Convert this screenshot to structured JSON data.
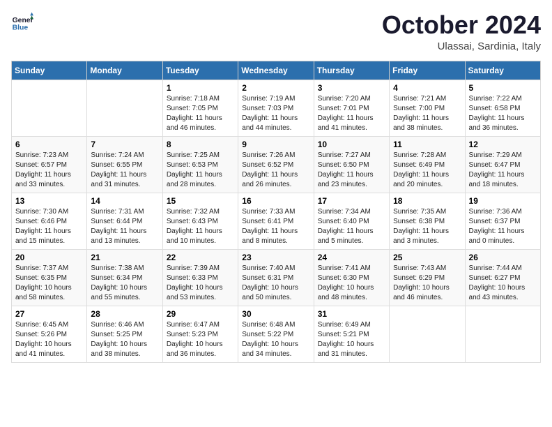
{
  "header": {
    "logo_line1": "General",
    "logo_line2": "Blue",
    "month_title": "October 2024",
    "location": "Ulassai, Sardinia, Italy"
  },
  "days_of_week": [
    "Sunday",
    "Monday",
    "Tuesday",
    "Wednesday",
    "Thursday",
    "Friday",
    "Saturday"
  ],
  "weeks": [
    [
      {
        "day": "",
        "sunrise": "",
        "sunset": "",
        "daylight": ""
      },
      {
        "day": "",
        "sunrise": "",
        "sunset": "",
        "daylight": ""
      },
      {
        "day": "1",
        "sunrise": "Sunrise: 7:18 AM",
        "sunset": "Sunset: 7:05 PM",
        "daylight": "Daylight: 11 hours and 46 minutes."
      },
      {
        "day": "2",
        "sunrise": "Sunrise: 7:19 AM",
        "sunset": "Sunset: 7:03 PM",
        "daylight": "Daylight: 11 hours and 44 minutes."
      },
      {
        "day": "3",
        "sunrise": "Sunrise: 7:20 AM",
        "sunset": "Sunset: 7:01 PM",
        "daylight": "Daylight: 11 hours and 41 minutes."
      },
      {
        "day": "4",
        "sunrise": "Sunrise: 7:21 AM",
        "sunset": "Sunset: 7:00 PM",
        "daylight": "Daylight: 11 hours and 38 minutes."
      },
      {
        "day": "5",
        "sunrise": "Sunrise: 7:22 AM",
        "sunset": "Sunset: 6:58 PM",
        "daylight": "Daylight: 11 hours and 36 minutes."
      }
    ],
    [
      {
        "day": "6",
        "sunrise": "Sunrise: 7:23 AM",
        "sunset": "Sunset: 6:57 PM",
        "daylight": "Daylight: 11 hours and 33 minutes."
      },
      {
        "day": "7",
        "sunrise": "Sunrise: 7:24 AM",
        "sunset": "Sunset: 6:55 PM",
        "daylight": "Daylight: 11 hours and 31 minutes."
      },
      {
        "day": "8",
        "sunrise": "Sunrise: 7:25 AM",
        "sunset": "Sunset: 6:53 PM",
        "daylight": "Daylight: 11 hours and 28 minutes."
      },
      {
        "day": "9",
        "sunrise": "Sunrise: 7:26 AM",
        "sunset": "Sunset: 6:52 PM",
        "daylight": "Daylight: 11 hours and 26 minutes."
      },
      {
        "day": "10",
        "sunrise": "Sunrise: 7:27 AM",
        "sunset": "Sunset: 6:50 PM",
        "daylight": "Daylight: 11 hours and 23 minutes."
      },
      {
        "day": "11",
        "sunrise": "Sunrise: 7:28 AM",
        "sunset": "Sunset: 6:49 PM",
        "daylight": "Daylight: 11 hours and 20 minutes."
      },
      {
        "day": "12",
        "sunrise": "Sunrise: 7:29 AM",
        "sunset": "Sunset: 6:47 PM",
        "daylight": "Daylight: 11 hours and 18 minutes."
      }
    ],
    [
      {
        "day": "13",
        "sunrise": "Sunrise: 7:30 AM",
        "sunset": "Sunset: 6:46 PM",
        "daylight": "Daylight: 11 hours and 15 minutes."
      },
      {
        "day": "14",
        "sunrise": "Sunrise: 7:31 AM",
        "sunset": "Sunset: 6:44 PM",
        "daylight": "Daylight: 11 hours and 13 minutes."
      },
      {
        "day": "15",
        "sunrise": "Sunrise: 7:32 AM",
        "sunset": "Sunset: 6:43 PM",
        "daylight": "Daylight: 11 hours and 10 minutes."
      },
      {
        "day": "16",
        "sunrise": "Sunrise: 7:33 AM",
        "sunset": "Sunset: 6:41 PM",
        "daylight": "Daylight: 11 hours and 8 minutes."
      },
      {
        "day": "17",
        "sunrise": "Sunrise: 7:34 AM",
        "sunset": "Sunset: 6:40 PM",
        "daylight": "Daylight: 11 hours and 5 minutes."
      },
      {
        "day": "18",
        "sunrise": "Sunrise: 7:35 AM",
        "sunset": "Sunset: 6:38 PM",
        "daylight": "Daylight: 11 hours and 3 minutes."
      },
      {
        "day": "19",
        "sunrise": "Sunrise: 7:36 AM",
        "sunset": "Sunset: 6:37 PM",
        "daylight": "Daylight: 11 hours and 0 minutes."
      }
    ],
    [
      {
        "day": "20",
        "sunrise": "Sunrise: 7:37 AM",
        "sunset": "Sunset: 6:35 PM",
        "daylight": "Daylight: 10 hours and 58 minutes."
      },
      {
        "day": "21",
        "sunrise": "Sunrise: 7:38 AM",
        "sunset": "Sunset: 6:34 PM",
        "daylight": "Daylight: 10 hours and 55 minutes."
      },
      {
        "day": "22",
        "sunrise": "Sunrise: 7:39 AM",
        "sunset": "Sunset: 6:33 PM",
        "daylight": "Daylight: 10 hours and 53 minutes."
      },
      {
        "day": "23",
        "sunrise": "Sunrise: 7:40 AM",
        "sunset": "Sunset: 6:31 PM",
        "daylight": "Daylight: 10 hours and 50 minutes."
      },
      {
        "day": "24",
        "sunrise": "Sunrise: 7:41 AM",
        "sunset": "Sunset: 6:30 PM",
        "daylight": "Daylight: 10 hours and 48 minutes."
      },
      {
        "day": "25",
        "sunrise": "Sunrise: 7:43 AM",
        "sunset": "Sunset: 6:29 PM",
        "daylight": "Daylight: 10 hours and 46 minutes."
      },
      {
        "day": "26",
        "sunrise": "Sunrise: 7:44 AM",
        "sunset": "Sunset: 6:27 PM",
        "daylight": "Daylight: 10 hours and 43 minutes."
      }
    ],
    [
      {
        "day": "27",
        "sunrise": "Sunrise: 6:45 AM",
        "sunset": "Sunset: 5:26 PM",
        "daylight": "Daylight: 10 hours and 41 minutes."
      },
      {
        "day": "28",
        "sunrise": "Sunrise: 6:46 AM",
        "sunset": "Sunset: 5:25 PM",
        "daylight": "Daylight: 10 hours and 38 minutes."
      },
      {
        "day": "29",
        "sunrise": "Sunrise: 6:47 AM",
        "sunset": "Sunset: 5:23 PM",
        "daylight": "Daylight: 10 hours and 36 minutes."
      },
      {
        "day": "30",
        "sunrise": "Sunrise: 6:48 AM",
        "sunset": "Sunset: 5:22 PM",
        "daylight": "Daylight: 10 hours and 34 minutes."
      },
      {
        "day": "31",
        "sunrise": "Sunrise: 6:49 AM",
        "sunset": "Sunset: 5:21 PM",
        "daylight": "Daylight: 10 hours and 31 minutes."
      },
      {
        "day": "",
        "sunrise": "",
        "sunset": "",
        "daylight": ""
      },
      {
        "day": "",
        "sunrise": "",
        "sunset": "",
        "daylight": ""
      }
    ]
  ]
}
